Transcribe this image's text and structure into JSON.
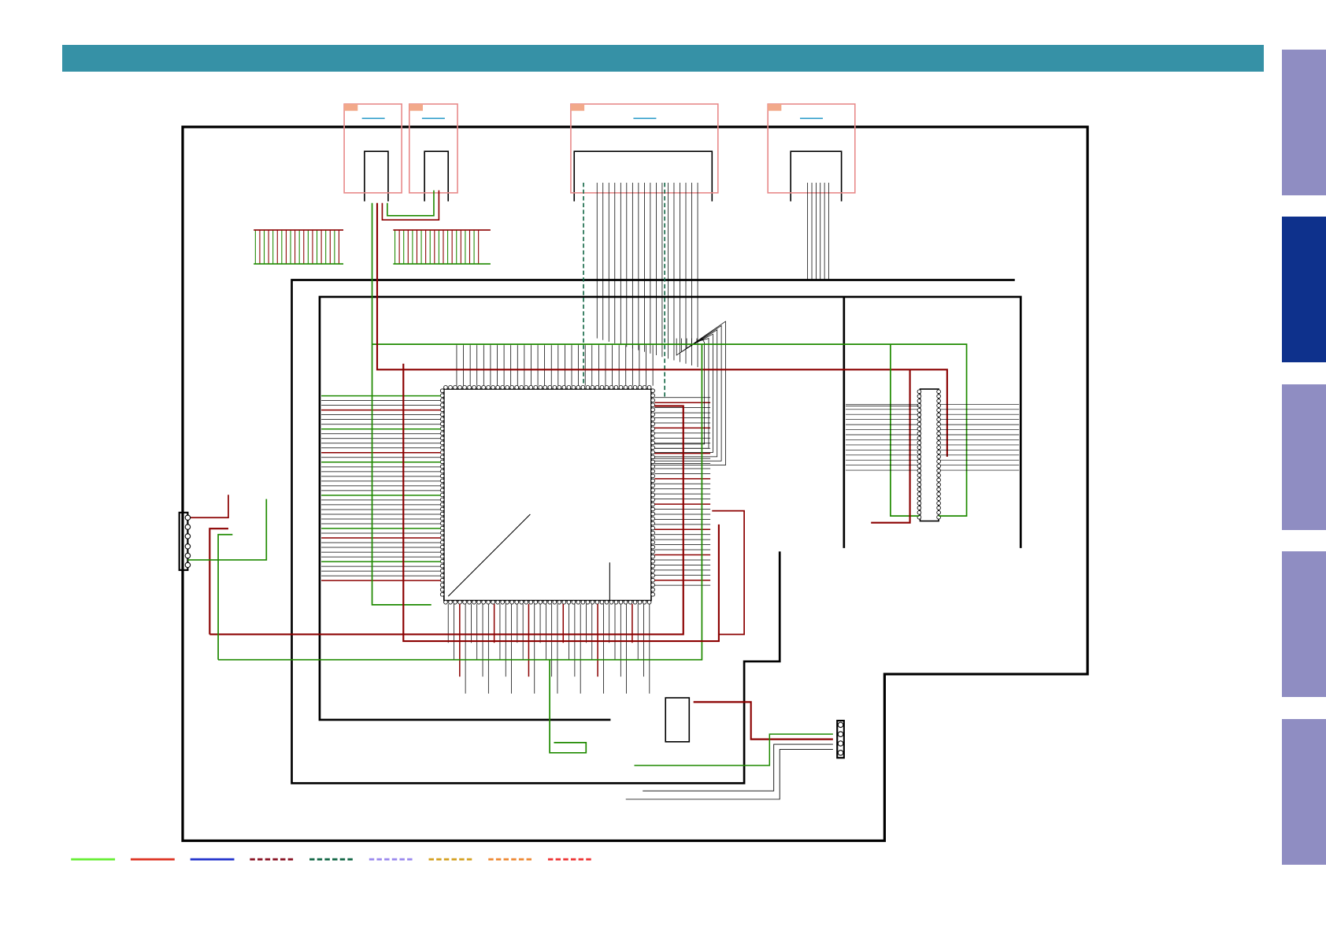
{
  "header": {
    "color": "#3691a6"
  },
  "side_tabs": [
    {
      "active": false
    },
    {
      "active": true
    },
    {
      "active": false
    },
    {
      "active": false
    },
    {
      "active": false
    }
  ],
  "colors": {
    "tab_inactive": "#8f8dc2",
    "tab_active": "#0e318c",
    "trace_green": "#1f8a00",
    "trace_red": "#8b0000",
    "wire": "#000000",
    "connector_frame": "#e88a8a",
    "connector_tag": "#f2a98a",
    "connector_label": "#2a9bc9"
  },
  "legend": [
    {
      "color": "#66ee33",
      "style": "solid"
    },
    {
      "color": "#dd3322",
      "style": "solid"
    },
    {
      "color": "#2233cc",
      "style": "solid"
    },
    {
      "color": "#881122",
      "style": "dashed"
    },
    {
      "color": "#116644",
      "style": "dashed"
    },
    {
      "color": "#9988ee",
      "style": "dashed"
    },
    {
      "color": "#d4a020",
      "style": "dashed"
    },
    {
      "color": "#ee8833",
      "style": "dashed"
    },
    {
      "color": "#ee3333",
      "style": "dashed"
    }
  ]
}
